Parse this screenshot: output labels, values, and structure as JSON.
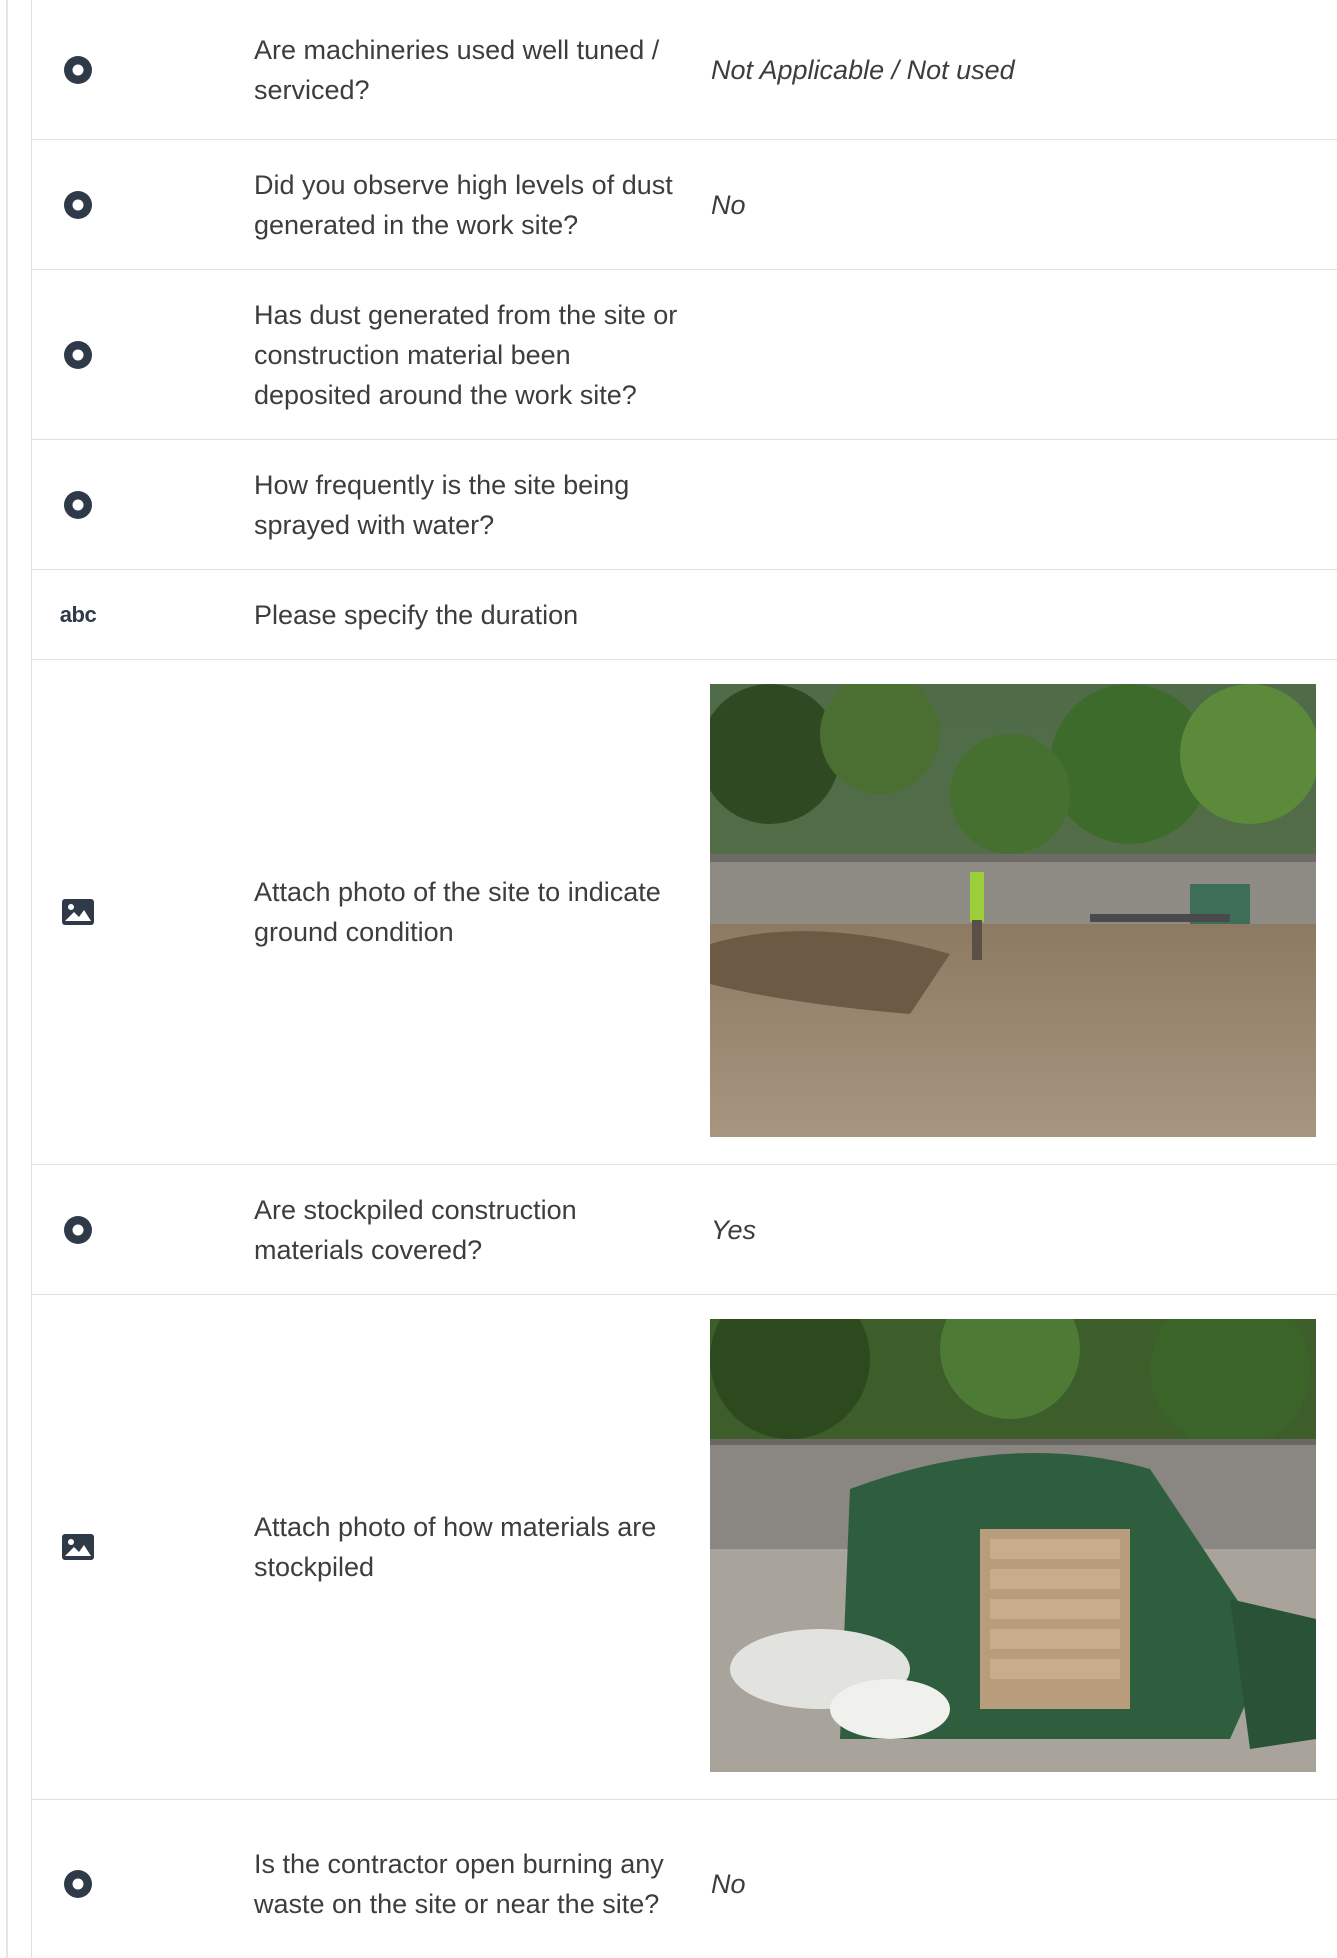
{
  "rows": [
    {
      "type": "radio",
      "question": "Are machineries used well tuned / serviced?",
      "answer": "Not Applicable / Not used"
    },
    {
      "type": "radio",
      "question": "Did you observe high levels of dust generated in the work site?",
      "answer": "No"
    },
    {
      "type": "radio",
      "question": "Has dust generated from the site or construction material been deposited around the work site?",
      "answer": ""
    },
    {
      "type": "radio",
      "question": "How frequently is the site being sprayed with water?",
      "answer": ""
    },
    {
      "type": "text",
      "icon_label": "abc",
      "question": "Please specify the duration",
      "answer": ""
    },
    {
      "type": "photo",
      "question": "Attach photo of the site to indicate ground condition",
      "photo_icon": "image-icon"
    },
    {
      "type": "radio",
      "question": "Are stockpiled construction materials covered?",
      "answer": "Yes"
    },
    {
      "type": "photo",
      "question": "Attach photo of how materials are stockpiled",
      "photo_icon": "image-icon"
    },
    {
      "type": "radio",
      "question": "Is the contractor open burning any waste on the site or near the site?",
      "answer": "No"
    }
  ],
  "icons": {
    "radio": "radio-selected-icon",
    "text": "text-abc-icon",
    "photo": "image-icon"
  },
  "colors": {
    "icon": "#2f3a48",
    "divider": "#e0e0e0",
    "text": "#3d3d3d"
  }
}
